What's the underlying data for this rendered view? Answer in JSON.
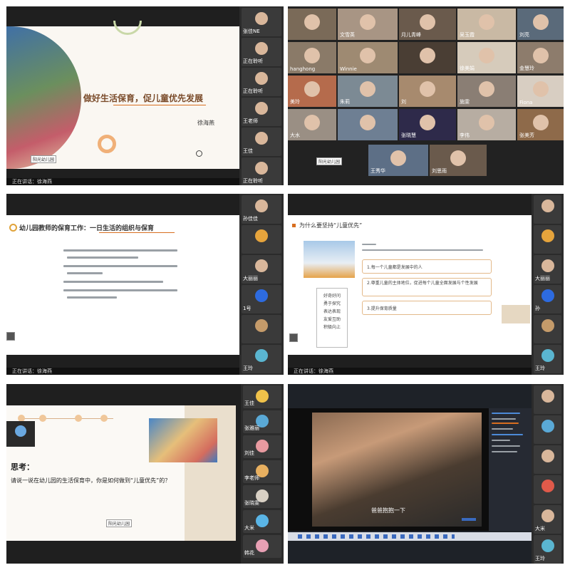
{
  "panels": {
    "p1": {
      "slide_title": "做好生活保育，促儿童优先发展",
      "author": "徐海燕",
      "badge": "阳光幼儿园",
      "footer": "正在讲话：徐海燕",
      "participants": [
        "张佳NE",
        "正在聆听",
        "正在聆听",
        "王老师",
        "王佳",
        "正在聆听"
      ]
    },
    "p2": {
      "names_row1": [
        "",
        "文雪英",
        "月儿青峰",
        "吴玉霞",
        "刘亮"
      ],
      "names_row2": [
        "hanghong",
        "Winnie",
        "",
        "徐美娟",
        "金慧玲"
      ],
      "names_row3": [
        "美玲",
        "朱莉",
        "刘",
        "施雯",
        "Fiona"
      ],
      "names_row4": [
        "大水",
        "",
        "张晓慧",
        "李伟",
        "张美芳"
      ],
      "names_row5": [
        "王秀华",
        "刘思雨"
      ],
      "badge": "阳光幼儿园"
    },
    "p3": {
      "heading": "幼儿园教师的保育工作：一日生活的组织与保育",
      "footer": "正在讲话：徐海燕",
      "participants": [
        "孙佳佳",
        "",
        "大丽丽",
        "",
        "1号",
        "",
        "王玲"
      ]
    },
    "p4": {
      "heading": "为什么要坚持“儿童优先”",
      "points": [
        "1.每一个儿童都是发展中的人",
        "2.尊重儿童的主体地位，促进每个儿童全面发展与个性发展",
        "3.提升保育质量"
      ],
      "keywords": [
        "好奇好问",
        "勇于探究",
        "表达表现",
        "友爱互助",
        "积极向上"
      ],
      "footer": "正在讲话：徐海燕",
      "participants": [
        "",
        "",
        "大丽丽",
        "",
        "孙",
        "",
        "王玲"
      ]
    },
    "p5": {
      "question_title": "思考：",
      "question": "请说一说在幼儿园的生活保育中，你是如何做到“儿童优先”的？",
      "badge": "阳光幼儿园",
      "participants": [
        "王佳",
        "张雅丽",
        "刘佳",
        "李老师",
        "张晓雯",
        "大米",
        "韩花"
      ]
    },
    "p6": {
      "subtitle": "爸爸抱抱一下",
      "participants": [
        "",
        "",
        "",
        "",
        "大米",
        "王玲"
      ]
    }
  }
}
